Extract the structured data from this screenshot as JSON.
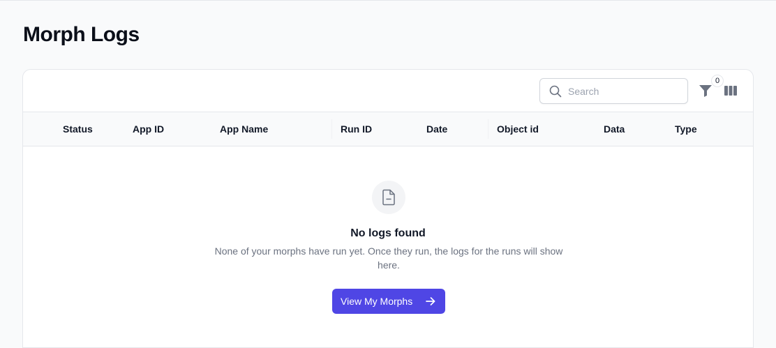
{
  "page": {
    "title": "Morph Logs"
  },
  "toolbar": {
    "search_placeholder": "Search",
    "search_value": "",
    "filter_count": "0",
    "icons": {
      "search": "search-icon",
      "filter": "filter-icon",
      "columns": "columns-icon"
    }
  },
  "table": {
    "columns": [
      "Status",
      "App ID",
      "App Name",
      "Run ID",
      "Date",
      "Object id",
      "Data",
      "Type"
    ]
  },
  "empty_state": {
    "icon": "document-icon",
    "title": "No logs found",
    "description": "None of your morphs have run yet. Once they run, the logs for the runs will show here.",
    "button_label": "View My Morphs",
    "button_icon": "arrow-right-icon"
  },
  "colors": {
    "accent": "#4f46e5",
    "background": "#f9fafb",
    "border": "#e5e7eb"
  }
}
